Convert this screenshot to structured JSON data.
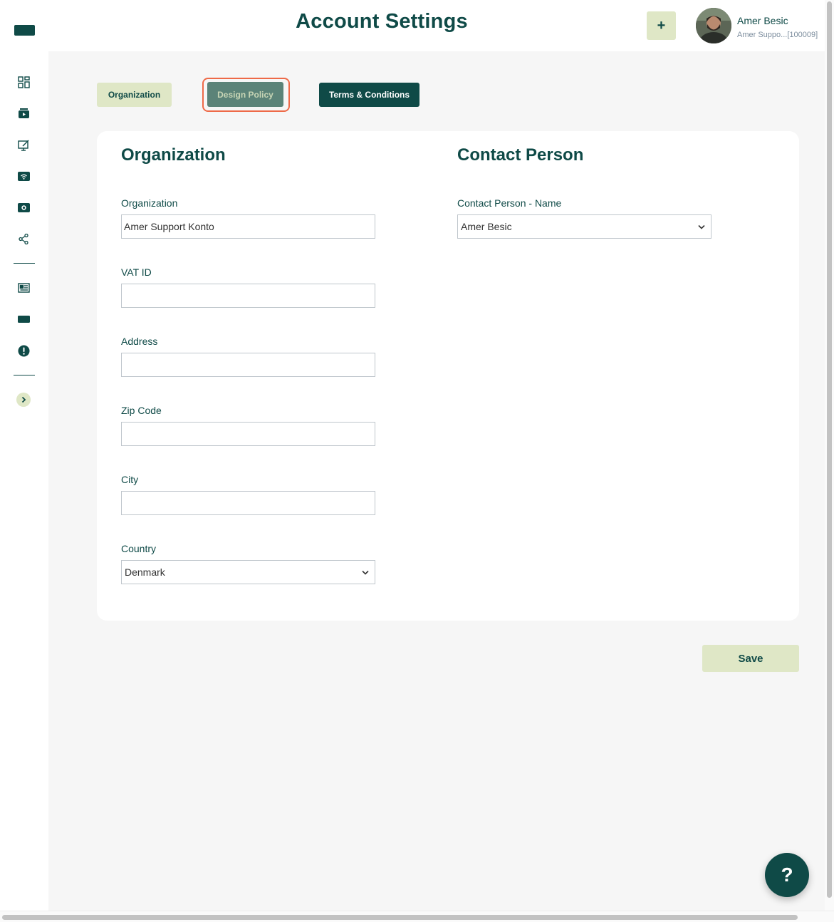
{
  "header": {
    "title": "Account Settings",
    "add_label": "+",
    "user_name": "Amer Besic",
    "user_sub": "Amer Suppo...[100009]"
  },
  "sidebar": {
    "icons": [
      "grid-icon",
      "video-icon",
      "edit-screen-icon",
      "wifi-icon",
      "media-icon",
      "share-icon",
      "newspaper-icon",
      "display-icon",
      "alert-icon",
      "chevron-right-icon"
    ]
  },
  "tabs": [
    {
      "label": "Organization"
    },
    {
      "label": "Design Policy"
    },
    {
      "label": "Terms & Conditions"
    }
  ],
  "organization": {
    "title": "Organization",
    "fields": [
      {
        "label": "Organization",
        "value": "Amer Support Konto"
      },
      {
        "label": "VAT ID",
        "value": ""
      },
      {
        "label": "Address",
        "value": ""
      },
      {
        "label": "Zip Code",
        "value": ""
      },
      {
        "label": "City",
        "value": ""
      },
      {
        "label": "Country",
        "value": "Denmark"
      }
    ]
  },
  "contact": {
    "title": "Contact Person",
    "name_label": "Contact Person - Name",
    "name_value": "Amer Besic"
  },
  "actions": {
    "save_label": "Save",
    "help_label": "?"
  },
  "colors": {
    "primary": "#0f4a47",
    "accent_light": "#dfe7c6",
    "highlight": "#ee6a48",
    "background": "#f6f6f6"
  }
}
